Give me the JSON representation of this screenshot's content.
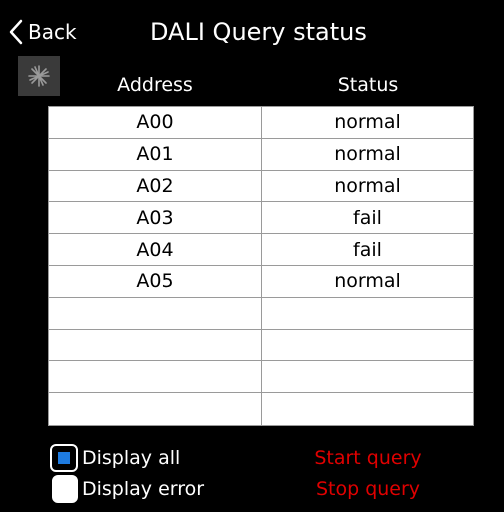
{
  "header": {
    "back_label": "Back",
    "title": "DALI Query status",
    "back_icon": "chevron-left-icon",
    "spinner_icon": "loading-spinner-icon"
  },
  "table": {
    "columns": [
      "Address",
      "Status"
    ],
    "rows": [
      {
        "address": "A00",
        "status": "normal"
      },
      {
        "address": "A01",
        "status": "normal"
      },
      {
        "address": "A02",
        "status": "normal"
      },
      {
        "address": "A03",
        "status": "fail"
      },
      {
        "address": "A04",
        "status": "fail"
      },
      {
        "address": "A05",
        "status": "normal"
      },
      {
        "address": "",
        "status": ""
      },
      {
        "address": "",
        "status": ""
      },
      {
        "address": "",
        "status": ""
      },
      {
        "address": "",
        "status": ""
      }
    ]
  },
  "options": {
    "display_all": {
      "label": "Display all",
      "selected": true
    },
    "display_error": {
      "label": "Display error",
      "selected": false
    }
  },
  "actions": {
    "start_query": "Start query",
    "stop_query": "Stop query"
  },
  "colors": {
    "background": "#000000",
    "action_text": "#e00000",
    "selected_indicator": "#1e7be0",
    "table_background": "#ffffff"
  }
}
